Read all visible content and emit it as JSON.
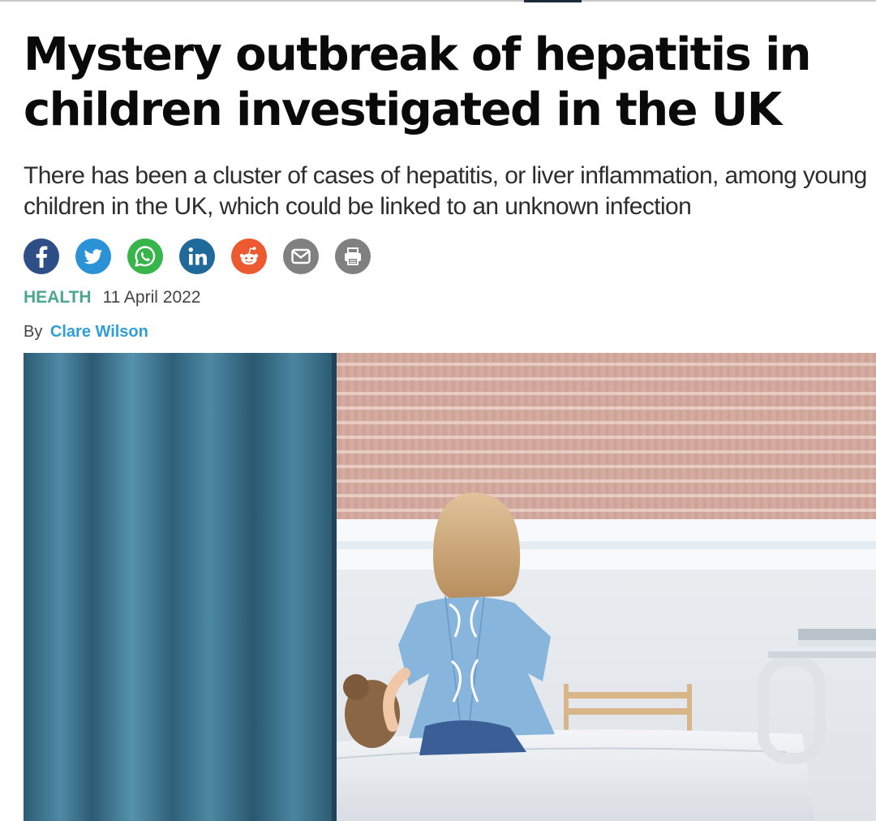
{
  "article": {
    "headline": "Mystery outbreak of hepatitis in children investigated in the UK",
    "standfirst_line1": "There has been a cluster of cases of hepatitis, or liver inflammation, among young",
    "standfirst_line2": "children in the UK, which could be linked to an unknown infection",
    "section": "HEALTH",
    "date": "11 April 2022",
    "byline_prefix": "By",
    "author": "Clare Wilson"
  },
  "share": [
    {
      "name": "facebook",
      "icon": "facebook-icon",
      "color": "#2d4e86"
    },
    {
      "name": "twitter",
      "icon": "twitter-icon",
      "color": "#2b92d6"
    },
    {
      "name": "whatsapp",
      "icon": "whatsapp-icon",
      "color": "#37b44a"
    },
    {
      "name": "linkedin",
      "icon": "linkedin-icon",
      "color": "#1f6a9a"
    },
    {
      "name": "reddit",
      "icon": "reddit-icon",
      "color": "#ee5a30"
    },
    {
      "name": "email",
      "icon": "email-icon",
      "color": "#808080"
    },
    {
      "name": "print",
      "icon": "print-icon",
      "color": "#808080"
    }
  ],
  "colors": {
    "section": "#4aa98a",
    "author_link": "#2f9fd4"
  }
}
